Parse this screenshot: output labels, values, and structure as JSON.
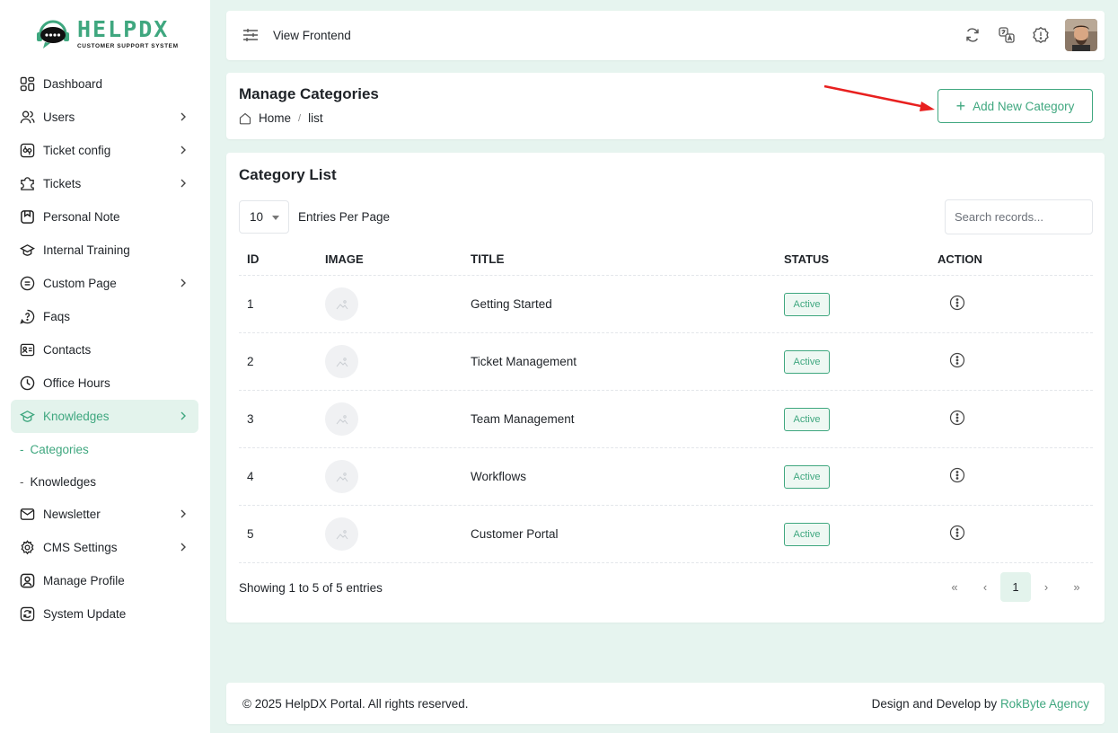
{
  "brand": {
    "name": "HELPDX",
    "tagline": "CUSTOMER SUPPORT SYSTEM",
    "accent": "#3fa77f"
  },
  "sidebar": {
    "items": [
      {
        "label": "Dashboard",
        "icon": "dashboard-icon",
        "has_children": false
      },
      {
        "label": "Users",
        "icon": "users-icon",
        "has_children": true
      },
      {
        "label": "Ticket config",
        "icon": "ticket-config-icon",
        "has_children": true
      },
      {
        "label": "Tickets",
        "icon": "tickets-icon",
        "has_children": true
      },
      {
        "label": "Personal Note",
        "icon": "note-icon",
        "has_children": false
      },
      {
        "label": "Internal Training",
        "icon": "training-icon",
        "has_children": false
      },
      {
        "label": "Custom Page",
        "icon": "custom-page-icon",
        "has_children": true
      },
      {
        "label": "Faqs",
        "icon": "faq-icon",
        "has_children": false
      },
      {
        "label": "Contacts",
        "icon": "contacts-icon",
        "has_children": false
      },
      {
        "label": "Office Hours",
        "icon": "clock-icon",
        "has_children": false
      },
      {
        "label": "Knowledges",
        "icon": "knowledge-icon",
        "has_children": true,
        "active": true
      },
      {
        "label": "Newsletter",
        "icon": "newsletter-icon",
        "has_children": true
      },
      {
        "label": "CMS Settings",
        "icon": "settings-icon",
        "has_children": true
      },
      {
        "label": "Manage Profile",
        "icon": "profile-icon",
        "has_children": false
      },
      {
        "label": "System Update",
        "icon": "update-icon",
        "has_children": false
      }
    ],
    "submenu": [
      {
        "label": "Categories",
        "active": true
      },
      {
        "label": "Knowledges",
        "active": false
      }
    ]
  },
  "topbar": {
    "view_frontend": "View Frontend"
  },
  "header": {
    "title": "Manage Categories",
    "breadcrumb": {
      "home": "Home",
      "sep": "/",
      "current": "list"
    },
    "add_button": "Add New Category"
  },
  "list": {
    "title": "Category List",
    "per_page": "10",
    "per_page_label": "Entries Per Page",
    "search_placeholder": "Search records...",
    "columns": [
      "ID",
      "IMAGE",
      "TITLE",
      "STATUS",
      "ACTION"
    ],
    "rows": [
      {
        "id": "1",
        "title": "Getting Started",
        "status": "Active"
      },
      {
        "id": "2",
        "title": "Ticket Management",
        "status": "Active"
      },
      {
        "id": "3",
        "title": "Team Management",
        "status": "Active"
      },
      {
        "id": "4",
        "title": "Workflows",
        "status": "Active"
      },
      {
        "id": "5",
        "title": "Customer Portal",
        "status": "Active"
      }
    ],
    "showing": "Showing 1 to 5 of 5 entries",
    "pagination": {
      "first": "«",
      "prev": "‹",
      "current": "1",
      "next": "›",
      "last": "»"
    }
  },
  "footer": {
    "copyright": "© 2025 HelpDX Portal. All rights reserved.",
    "credit_prefix": "Design and Develop by",
    "credit_link": "RokByte Agency"
  }
}
